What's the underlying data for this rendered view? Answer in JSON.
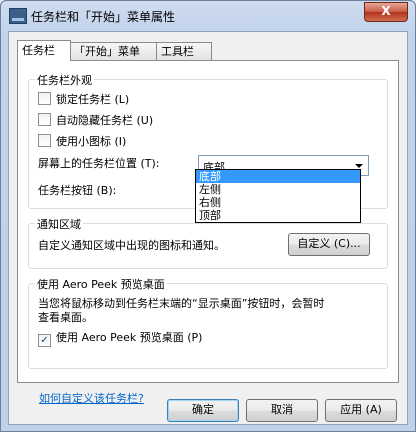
{
  "window": {
    "title": "任务栏和「开始」菜单属性",
    "close_label": "X"
  },
  "tabs": [
    {
      "label": "任务栏",
      "active": true
    },
    {
      "label": "「开始」菜单",
      "active": false
    },
    {
      "label": "工具栏",
      "active": false
    }
  ],
  "appearance": {
    "title": "任务栏外观",
    "lock_label": "锁定任务栏 (L)",
    "lock_checked": false,
    "autohide_label": "自动隐藏任务栏 (U)",
    "autohide_checked": false,
    "small_icons_label": "使用小图标 (I)",
    "small_icons_checked": false,
    "position_label": "屏幕上的任务栏位置 (T):",
    "position_value": "底部",
    "position_options": [
      "底部",
      "左侧",
      "右侧",
      "顶部"
    ],
    "buttons_label": "任务栏按钮 (B):"
  },
  "notification": {
    "title": "通知区域",
    "description": "自定义通知区域中出现的图标和通知。",
    "customize_button": "自定义 (C)..."
  },
  "aero_peek": {
    "title": "使用 Aero Peek 预览桌面",
    "description_line1": "当您将鼠标移动到任务栏末端的“显示桌面”按钮时，会暂时",
    "description_line2": "查看桌面。",
    "checkbox_label": "使用 Aero Peek 预览桌面 (P)",
    "checkbox_checked": true
  },
  "help_link": "如何自定义该任务栏?",
  "footer": {
    "ok": "确定",
    "cancel": "取消",
    "apply": "应用 (A)"
  }
}
